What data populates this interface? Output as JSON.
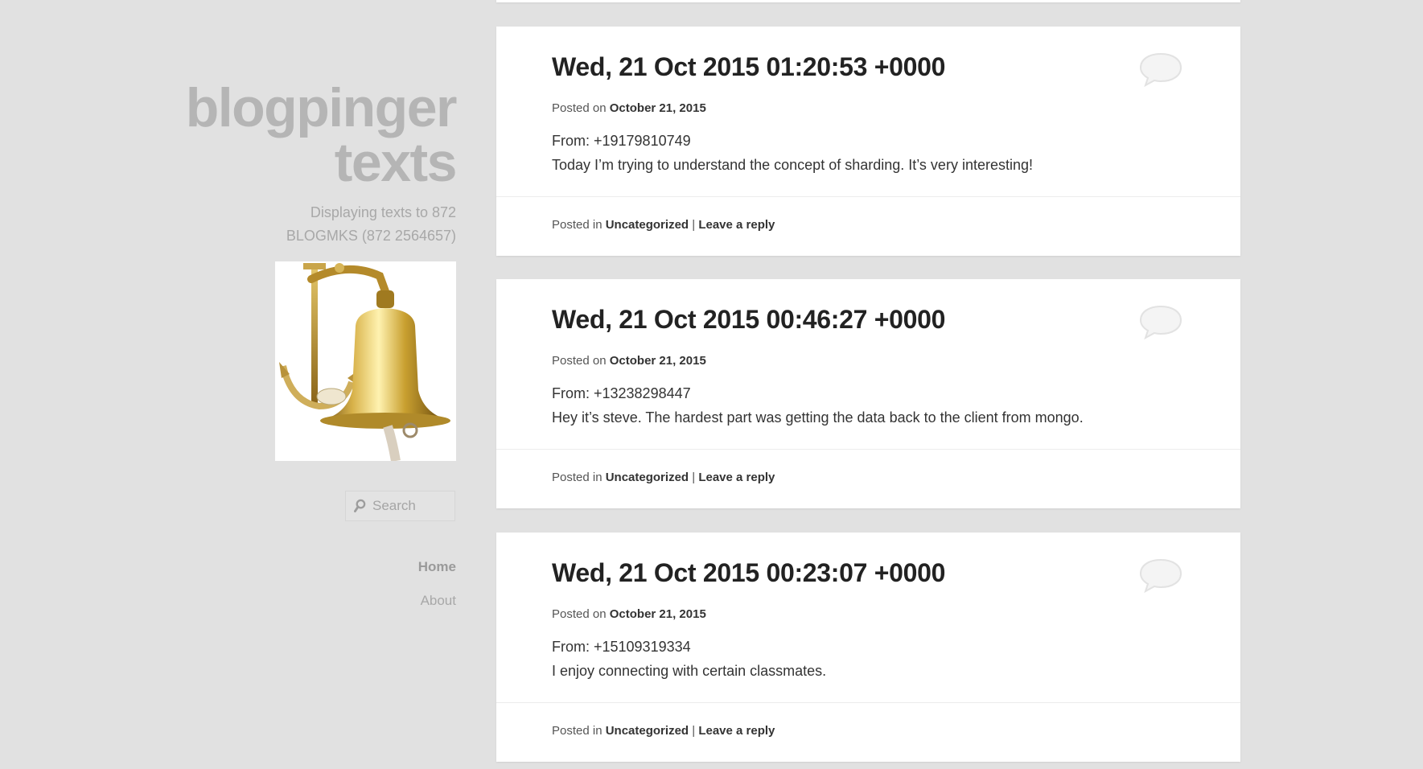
{
  "site": {
    "title_line1": "blogpinger",
    "title_line2": "texts",
    "description_line1": "Displaying texts to 872",
    "description_line2": "BLOGMKS (872 2564657)"
  },
  "search": {
    "placeholder": "Search"
  },
  "nav": {
    "items": [
      {
        "label": "Home"
      },
      {
        "label": "About"
      }
    ]
  },
  "posts": [
    {
      "title": "Wed, 21 Oct 2015 01:20:53 +0000",
      "posted_prefix": "Posted on",
      "date": "October 21, 2015",
      "from": "From: +19179810749",
      "body": "Today I’m trying to understand the concept of sharding. It’s very interesting!",
      "footer_prefix": "Posted in",
      "category": "Uncategorized",
      "separator": "|",
      "reply": "Leave a reply"
    },
    {
      "title": "Wed, 21 Oct 2015 00:46:27 +0000",
      "posted_prefix": "Posted on",
      "date": "October 21, 2015",
      "from": "From: +13238298447",
      "body": "Hey it’s steve. The hardest part was getting the data back to the client from mongo.",
      "footer_prefix": "Posted in",
      "category": "Uncategorized",
      "separator": "|",
      "reply": "Leave a reply"
    },
    {
      "title": "Wed, 21 Oct 2015 00:23:07 +0000",
      "posted_prefix": "Posted on",
      "date": "October 21, 2015",
      "from": "From: +15109319334",
      "body": "I enjoy connecting with certain classmates.",
      "footer_prefix": "Posted in",
      "category": "Uncategorized",
      "separator": "|",
      "reply": "Leave a reply"
    }
  ],
  "colors": {
    "background": "#e1e1e1",
    "card": "#ffffff",
    "title_text": "#222222",
    "sidebar_text": "#b5b5b5"
  },
  "icons": {
    "search": "search-icon",
    "comment": "comment-bubble-icon"
  }
}
